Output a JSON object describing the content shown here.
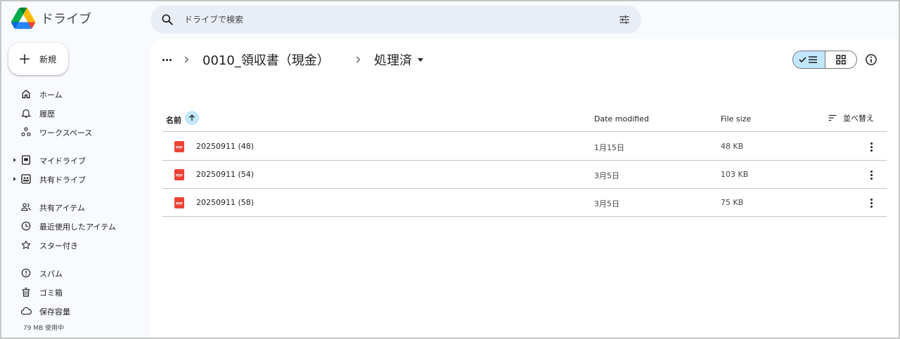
{
  "app": {
    "name": "ドライブ"
  },
  "search": {
    "placeholder": "ドライブで検索"
  },
  "new_button": {
    "label": "新規"
  },
  "sidebar": {
    "items": [
      {
        "label": "ホーム",
        "icon": "home-icon"
      },
      {
        "label": "履歴",
        "icon": "bell-icon"
      },
      {
        "label": "ワークスペース",
        "icon": "workspace-icon"
      },
      {
        "label": "マイドライブ",
        "icon": "my-drive-icon"
      },
      {
        "label": "共有ドライブ",
        "icon": "shared-drives-icon"
      },
      {
        "label": "共有アイテム",
        "icon": "people-icon"
      },
      {
        "label": "最近使用したアイテム",
        "icon": "clock-icon"
      },
      {
        "label": "スター付き",
        "icon": "star-icon"
      },
      {
        "label": "スパム",
        "icon": "spam-icon"
      },
      {
        "label": "ゴミ箱",
        "icon": "trash-icon"
      },
      {
        "label": "保存容量",
        "icon": "cloud-icon"
      }
    ],
    "storage_used": "79 MB 使用中"
  },
  "breadcrumb": {
    "parent": "0010_領収書（現金）",
    "current": "処理済"
  },
  "table": {
    "headers": {
      "name": "名前",
      "date": "Date modified",
      "size": "File size",
      "sort": "並べ替え"
    },
    "rows": [
      {
        "name": "20250911 (48)",
        "date": "1月15日",
        "size": "48 KB",
        "type_badge": "PDF"
      },
      {
        "name": "20250911 (54)",
        "date": "3月5日",
        "size": "103 KB",
        "type_badge": "PDF"
      },
      {
        "name": "20250911 (58)",
        "date": "3月5日",
        "size": "75 KB",
        "type_badge": "PDF"
      }
    ]
  },
  "colors": {
    "accent_light": "#c2e7ff",
    "search_bg": "#e9eef6",
    "sidebar_bg": "#f8fafd",
    "pdf_red": "#ea4335"
  }
}
